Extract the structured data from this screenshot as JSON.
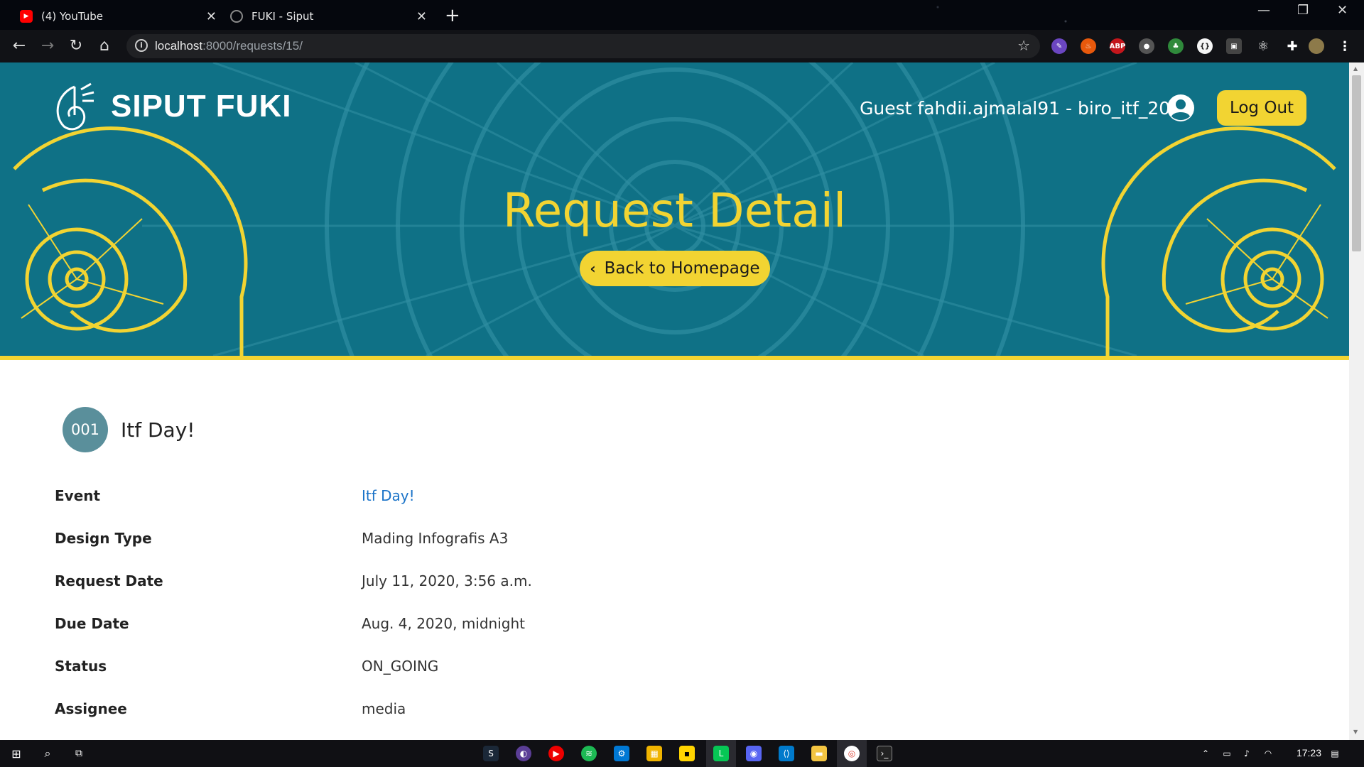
{
  "browser": {
    "tabs": [
      {
        "title": "(4) YouTube",
        "favicon": "youtube-icon",
        "color": "#ff0000"
      },
      {
        "title": "FUKI - Siput",
        "favicon": "globe-icon",
        "color": "#8a8a8a"
      }
    ],
    "url_host": "localhost",
    "url_rest": ":8000/requests/15/"
  },
  "header": {
    "brand": "SIPUT FUKI",
    "user": "Guest fahdii.ajmalal91 - biro_itf_2020",
    "logout_label": "Log Out",
    "page_title": "Request Detail",
    "back_label": "Back to Homepage"
  },
  "request": {
    "number": "001",
    "title": "Itf Day!",
    "fields": [
      {
        "label": "Event",
        "value": "Itf Day!",
        "link": true
      },
      {
        "label": "Design Type",
        "value": "Mading Infografis A3",
        "link": false
      },
      {
        "label": "Request Date",
        "value": "July 11, 2020, 3:56 a.m.",
        "link": false
      },
      {
        "label": "Due Date",
        "value": "Aug. 4, 2020, midnight",
        "link": false
      },
      {
        "label": "Status",
        "value": "ON_GOING",
        "link": false
      },
      {
        "label": "Assignee",
        "value": "media",
        "link": false
      }
    ]
  },
  "taskbar": {
    "time": "17:23"
  },
  "colors": {
    "teal": "#0f7186",
    "yellow": "#f2d432",
    "link": "#1a73c8",
    "badge": "#5a8f9b"
  }
}
